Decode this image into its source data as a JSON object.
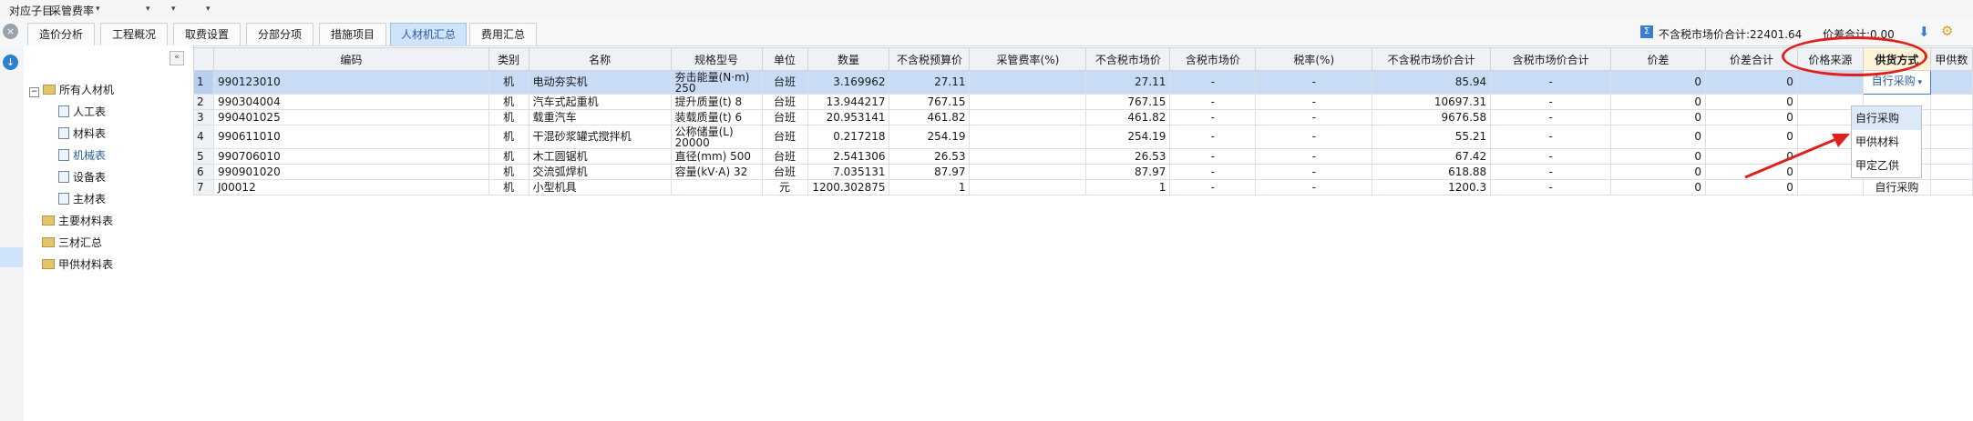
{
  "topbar": {
    "label1": "对应子目",
    "label2": "采管费率",
    "arrows": [
      "▾",
      "▾",
      "▾",
      "▾"
    ]
  },
  "tabs": [
    "造价分析",
    "工程概况",
    "取费设置",
    "分部分项",
    "措施项目",
    "人材机汇总",
    "费用汇总"
  ],
  "active_tab_index": 5,
  "status": {
    "market_total": "不含税市场价合计:22401.64",
    "diff_total": "价差合计:0.00"
  },
  "tree": {
    "root": "所有人材机",
    "children": [
      "人工表",
      "材料表",
      "机械表",
      "设备表",
      "主材表"
    ],
    "top_items": [
      "主要材料表",
      "三材汇总",
      "甲供材料表"
    ]
  },
  "table": {
    "headers": [
      "",
      "编码",
      "类别",
      "名称",
      "规格型号",
      "单位",
      "数量",
      "不含税预算价",
      "采管费率(%)",
      "不含税市场价",
      "含税市场价",
      "税率(%)",
      "不含税市场价合计",
      "含税市场价合计",
      "价差",
      "价差合计",
      "价格来源",
      "供货方式",
      "甲供数"
    ],
    "rows": [
      [
        "1",
        "990123010",
        "机",
        "电动夯实机",
        "夯击能量(N·m)\n250",
        "台班",
        "3.169962",
        "27.11",
        "",
        "27.11",
        "-",
        "-",
        "85.94",
        "-",
        "0",
        "0",
        "",
        "自行采购",
        ""
      ],
      [
        "2",
        "990304004",
        "机",
        "汽车式起重机",
        "提升质量(t) 8",
        "台班",
        "13.944217",
        "767.15",
        "",
        "767.15",
        "-",
        "-",
        "10697.31",
        "-",
        "0",
        "0",
        "",
        "",
        ""
      ],
      [
        "3",
        "990401025",
        "机",
        "载重汽车",
        "装载质量(t) 6",
        "台班",
        "20.953141",
        "461.82",
        "",
        "461.82",
        "-",
        "-",
        "9676.58",
        "-",
        "0",
        "0",
        "",
        "",
        ""
      ],
      [
        "4",
        "990611010",
        "机",
        "干混砂浆罐式搅拌机",
        "公称储量(L)\n20000",
        "台班",
        "0.217218",
        "254.19",
        "",
        "254.19",
        "-",
        "-",
        "55.21",
        "-",
        "0",
        "0",
        "",
        "",
        ""
      ],
      [
        "5",
        "990706010",
        "机",
        "木工圆锯机",
        "直径(mm) 500",
        "台班",
        "2.541306",
        "26.53",
        "",
        "26.53",
        "-",
        "-",
        "67.42",
        "-",
        "0",
        "0",
        "",
        "自行采购",
        ""
      ],
      [
        "6",
        "990901020",
        "机",
        "交流弧焊机",
        "容量(kV·A) 32",
        "台班",
        "7.035131",
        "87.97",
        "",
        "87.97",
        "-",
        "-",
        "618.88",
        "-",
        "0",
        "0",
        "",
        "自行采购",
        ""
      ],
      [
        "7",
        "J00012",
        "机",
        "小型机具",
        "",
        "元",
        "1200.302875",
        "1",
        "",
        "1",
        "-",
        "-",
        "1200.3",
        "-",
        "0",
        "0",
        "",
        "自行采购",
        ""
      ]
    ]
  },
  "dropdown": {
    "options": [
      "自行采购",
      "甲供材料",
      "甲定乙供"
    ],
    "highlighted": 0
  },
  "colors": {
    "accent": "#2a5f9a",
    "selected_row": "#c9dcf6",
    "annotation": "#e0201b"
  },
  "icons": [
    "close-circle-icon",
    "down-circle-icon",
    "collapse-icon",
    "sigma-icon",
    "down-arrow-icon",
    "settings-icon"
  ]
}
